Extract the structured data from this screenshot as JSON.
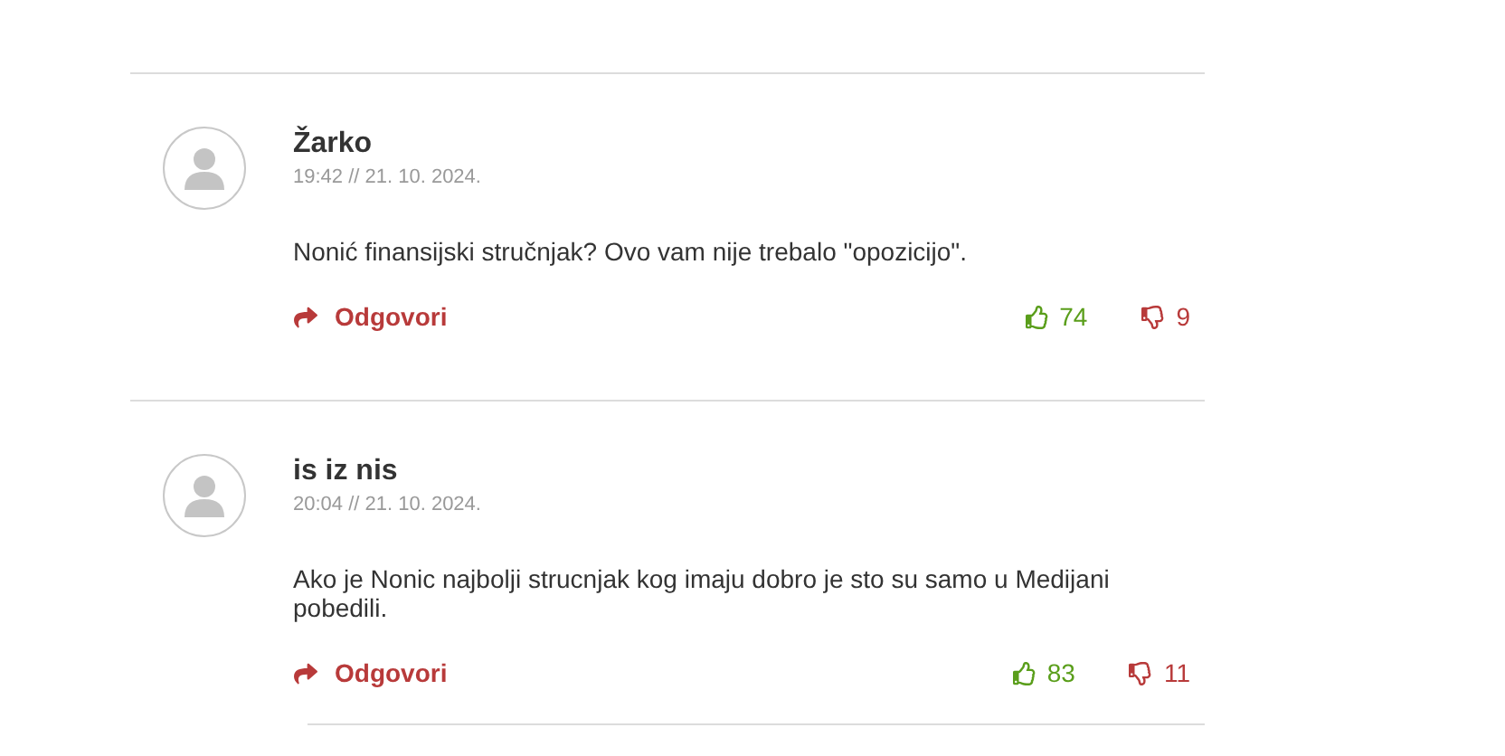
{
  "comments": [
    {
      "author": "Žarko",
      "date": "19:42 // 21. 10. 2024.",
      "text": "Nonić finansijski stručnjak? Ovo vam nije trebalo \"opozicijo\".",
      "reply": "Odgovori",
      "likes": "74",
      "dislikes": "9"
    },
    {
      "author": "is iz nis",
      "date": "20:04 // 21. 10. 2024.",
      "text": "Ako je Nonic najbolji strucnjak kog imaju dobro je sto su samo u Medijani pobedili.",
      "reply": "Odgovori",
      "likes": "83",
      "dislikes": "11"
    }
  ]
}
